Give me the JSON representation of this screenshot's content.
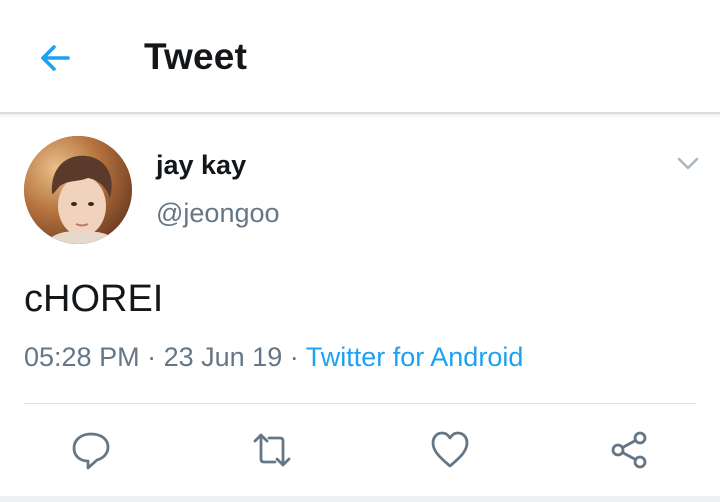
{
  "header": {
    "title": "Tweet",
    "back_icon": "arrow-left-icon"
  },
  "tweet": {
    "display_name": "jay kay",
    "handle": "@jeongoo",
    "text": "cHOREI",
    "time": "05:28 PM",
    "separator": "·",
    "date": "23 Jun 19",
    "source": "Twitter for Android"
  },
  "actions": [
    {
      "icon": "reply-icon"
    },
    {
      "icon": "retweet-icon"
    },
    {
      "icon": "like-icon"
    },
    {
      "icon": "share-icon"
    }
  ],
  "colors": {
    "accent": "#1da1f2",
    "text": "#14171a",
    "muted": "#657786",
    "icon": "#657786"
  }
}
